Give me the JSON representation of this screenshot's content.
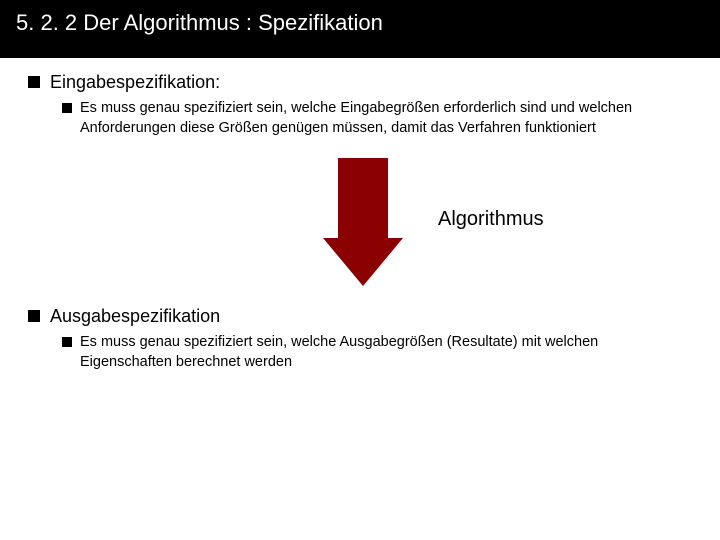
{
  "title": "5. 2. 2  Der Algorithmus : Spezifikation",
  "bullets": {
    "input": {
      "label": "Eingabespezifikation:",
      "detail": "Es muss genau spezifiziert sein, welche Eingabegrößen erforderlich sind und welchen Anforderungen diese Größen genügen müssen, damit das Verfahren funktioniert"
    },
    "output": {
      "label": "Ausgabespezifikation",
      "detail": "Es muss genau spezifiziert sein, welche Ausgabegrößen (Resultate) mit welchen Eigenschaften berechnet werden"
    }
  },
  "arrow": {
    "label": "Algorithmus",
    "color": "#8b0000"
  }
}
